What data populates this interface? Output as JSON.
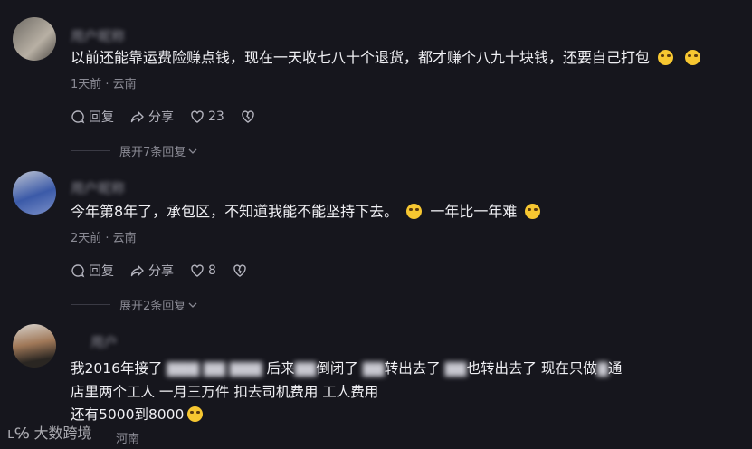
{
  "comments": [
    {
      "username": "用户昵称",
      "text": "以前还能靠运费险赚点钱，现在一天收七八十个退货，都才赚个八九十块钱，还要自己打包",
      "time_location": "1天前 · 云南",
      "reply_label": "回复",
      "share_label": "分享",
      "likes": "23",
      "expand_label": "展开7条回复"
    },
    {
      "username": "用户昵称",
      "text_part1": "今年第8年了，承包区，不知道我能不能坚持下去。",
      "text_part2": "一年比一年难",
      "time_location": "2天前 · 云南",
      "reply_label": "回复",
      "share_label": "分享",
      "likes": "8",
      "expand_label": "展开2条回复"
    },
    {
      "username": "用户",
      "line1_a": "我2016年接了",
      "line1_b": "后来",
      "line1_c": "倒闭了",
      "line1_d": "转出去了",
      "line1_e": "也转出去了  现在只做",
      "line1_f": "通",
      "line2": "店里两个工人 一月三万件 扣去司机费用 工人费用",
      "line3": "还有5000到8000",
      "time_location": "河南"
    }
  ],
  "watermark": "大数跨境",
  "colors": {
    "background": "#16161d",
    "text": "#f0f0f4",
    "meta": "#8a8a94"
  }
}
